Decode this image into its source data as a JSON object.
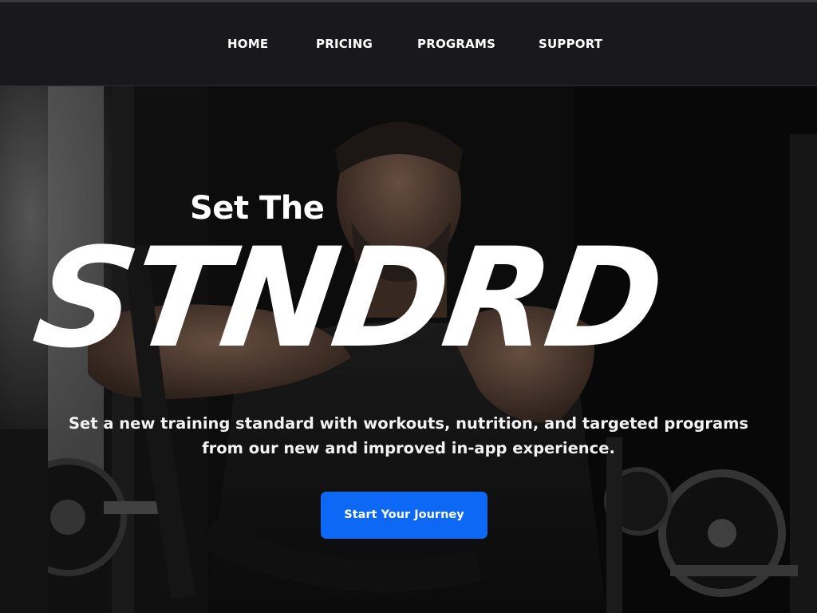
{
  "nav": {
    "items": [
      {
        "label": "HOME"
      },
      {
        "label": "PRICING"
      },
      {
        "label": "PROGRAMS"
      },
      {
        "label": "SUPPORT"
      }
    ]
  },
  "hero": {
    "kicker": "Set The",
    "wordmark": "STNDRD",
    "subtitle_line1": "Set a new training standard with workouts, nutrition, and targeted programs",
    "subtitle_line2": "from our new and improved in-app experience.",
    "cta_label": "Start Your Journey",
    "background_image": "man-lifting-weights-in-gym-photo"
  },
  "colors": {
    "navbar_bg": "#19181a",
    "cta_bg": "#0d68f5",
    "text": "#ffffff"
  }
}
